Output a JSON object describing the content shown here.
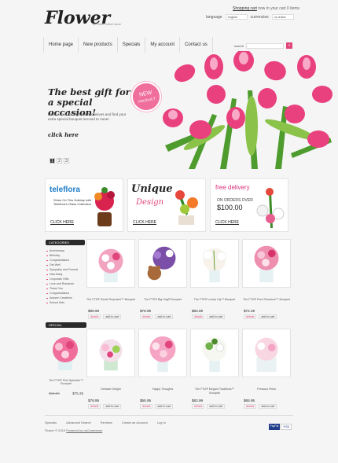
{
  "header": {
    "logo": "Flower",
    "slogan": "the best online store",
    "cart_link": "Shopping cart",
    "cart_info": "now in your cart 0 items",
    "language_label": "language",
    "language_value": "english",
    "currencies_label": "currencies",
    "currencies_value": "us dollar"
  },
  "nav": [
    "Home page",
    "New products",
    "Specials",
    "My account",
    "Contact us"
  ],
  "search": {
    "label": "search",
    "button": "»"
  },
  "hero": {
    "title": "The best gift for a special occasion!",
    "text": "Have a look through our exclusives and find your extra special bouquet second to none!",
    "link": "click here",
    "badge_top": "NEW",
    "badge_bottom": "PRODUCT"
  },
  "pager": [
    "1",
    "2",
    "3"
  ],
  "banners": [
    {
      "brand": "teleflora",
      "text": "Shine On This Holiday with Teleflora's Glass Collection",
      "cta": "CLICK HERE"
    },
    {
      "line1": "Unique",
      "line2": "Design",
      "cta": "CLICK HERE"
    },
    {
      "line1": "free delivery",
      "line2": "ON ORDERS OVER",
      "line3": "$100.00",
      "cta": "CLICK HERE"
    }
  ],
  "sidebar": {
    "categories_title": "CATEGORIES",
    "categories": [
      "Anniversary",
      "Birthday",
      "Congratulations",
      "Get Well",
      "Sympathy and Funeral",
      "New Baby",
      "Corporate Gifts",
      "Love and Romance",
      "Thank You",
      "Congratulations",
      "Autumn Creations",
      "School Kids"
    ],
    "special_title": "SPECIAL",
    "special_item": {
      "name": "The FTD® Pink Splendor™ Bouquet",
      "old_price": "$99.50",
      "price": "$75.25"
    }
  },
  "products": [
    {
      "name": "The FTD® Sweet Surprises™ Bouquet",
      "price": "$99.99"
    },
    {
      "name": "The FTD® Big Hug® Bouquet",
      "price": "$78.99"
    },
    {
      "name": "The FTD® Lovely Lily™ Bouquet",
      "price": "$83.99"
    },
    {
      "name": "The FTD® Pure Romance™ Bouquet",
      "price": "$72.29"
    },
    {
      "name": "Delicate Delight",
      "price": "$78.95"
    },
    {
      "name": "Happy Thoughts",
      "price": "$55.95"
    },
    {
      "name": "The FTD® Elegant Traditions™ Bouquet",
      "price": "$83.99"
    },
    {
      "name": "Precious Pinks",
      "price": "$65.95"
    }
  ],
  "buttons": {
    "details": "details",
    "add": "add to cart"
  },
  "footer": {
    "links": [
      "Specials",
      "Advanced Search",
      "Reviews",
      "Create an Account",
      "Log In"
    ],
    "copyright": "Flower © 2010",
    "powered": "Powered by osCommerce",
    "pay1": "PayPal",
    "pay2": "VISA"
  },
  "colors": {
    "accent": "#e0457b",
    "dark": "#2a2a2a"
  }
}
